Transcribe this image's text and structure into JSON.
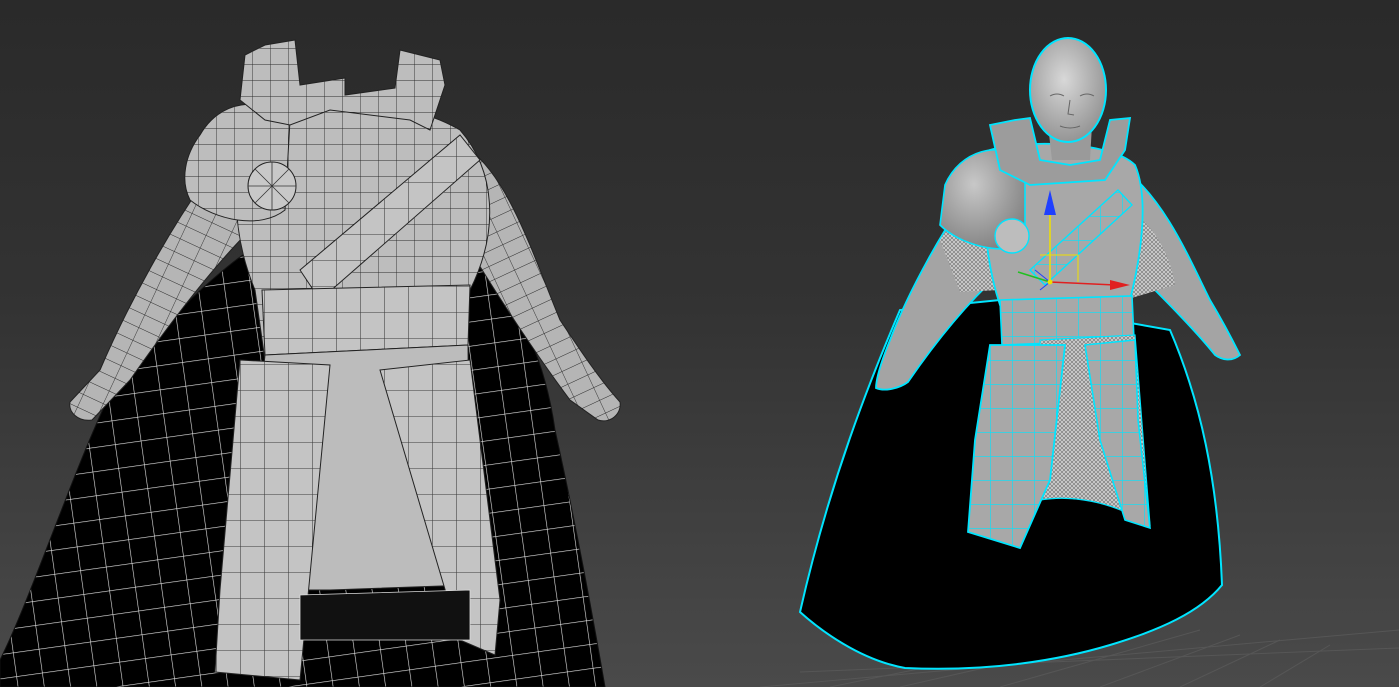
{
  "viewport": {
    "background_top": "#2a2a2a",
    "background_bottom": "#4a4a4a",
    "grid_color": "#5a5a5a"
  },
  "models": {
    "left": {
      "name": "armored-cloak-character",
      "display_mode": "shaded-with-wireframe",
      "surface_color": "#b9b9b9",
      "wire_color": "#1c1c1c",
      "cloak_color": "#000000",
      "cloak_wire_color": "#e6e6e6"
    },
    "right": {
      "name": "armored-cloak-character",
      "display_mode": "shaded-selected",
      "surface_color": "#9e9e9e",
      "selection_color": "#00e5ff",
      "cloak_color": "#000000",
      "chainmail_color": "#dcdcdc"
    }
  },
  "gizmo": {
    "x_axis_color": "#e02020",
    "y_axis_color": "#20c020",
    "z_axis_color": "#2040ff",
    "pivot_color": "#f0e000"
  }
}
